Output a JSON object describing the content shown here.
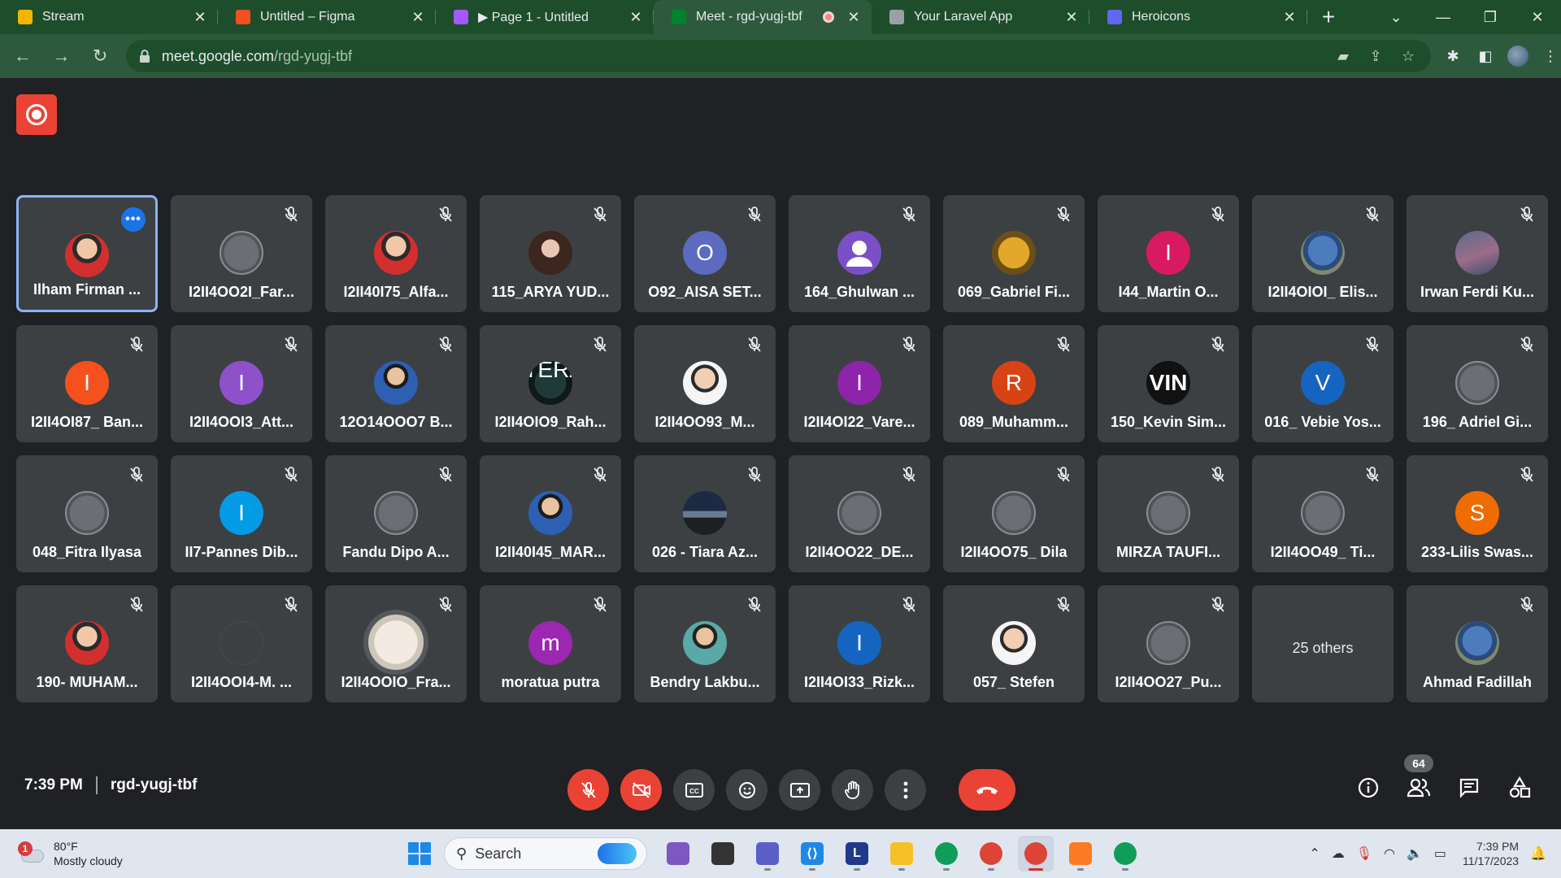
{
  "browser": {
    "tabs": [
      {
        "title": "Stream",
        "icon": "stream-icon",
        "color": "#f4b400"
      },
      {
        "title": "Untitled – Figma",
        "icon": "figma-icon",
        "color": "#f24e1e"
      },
      {
        "title": "▶ Page 1 - Untitled",
        "icon": "figma-icon",
        "color": "#a259ff"
      },
      {
        "title": "Meet - rgd-yugj-tbf",
        "icon": "meet-icon",
        "color": "#00832d",
        "active": true,
        "recording": true
      },
      {
        "title": "Your Laravel App",
        "icon": "globe-icon",
        "color": "#9aa0a6"
      },
      {
        "title": "Heroicons",
        "icon": "heroicons-icon",
        "color": "#6366f1"
      }
    ],
    "url_host": "meet.google.com",
    "url_path": "/rgd-yugj-tbf",
    "theme_color": "#2d5a3d"
  },
  "meeting": {
    "time": "7:39 PM",
    "code": "rgd-yugj-tbf",
    "participant_count": "64",
    "participants": [
      {
        "name": "Ilham Firman ...",
        "avatar": "photo",
        "speaking": true
      },
      {
        "name": "I2II4OO2I_Far...",
        "avatar": "grey"
      },
      {
        "name": "I2II40I75_Alfa...",
        "avatar": "photo"
      },
      {
        "name": "115_ARYA YUD...",
        "avatar": "anime"
      },
      {
        "name": "O92_AISA SET...",
        "avatar": "letter",
        "letter": "O",
        "color": "#5c6bc0"
      },
      {
        "name": "164_Ghulwan ...",
        "avatar": "person-icon",
        "color": "#7b4fc6"
      },
      {
        "name": "069_Gabriel Fi...",
        "avatar": "dog"
      },
      {
        "name": "I44_Martin O...",
        "avatar": "letter",
        "letter": "I",
        "color": "#d81b60"
      },
      {
        "name": "I2II4OIOI_ Elis...",
        "avatar": "logo"
      },
      {
        "name": "Irwan Ferdi Ku...",
        "avatar": "sky"
      },
      {
        "name": "I2II4OI87_ Ban...",
        "avatar": "letter",
        "letter": "I",
        "color": "#f4511e"
      },
      {
        "name": "I2II4OOI3_Att...",
        "avatar": "letter",
        "letter": "I",
        "color": "#8e51c9"
      },
      {
        "name": "12O14OOO7 B...",
        "avatar": "blueshirt"
      },
      {
        "name": "I2II4OIO9_Rah...",
        "avatar": "dark",
        "label": "ITERA II"
      },
      {
        "name": "I2II4OO93_M...",
        "avatar": "white"
      },
      {
        "name": "I2II4OI22_Vare...",
        "avatar": "letter",
        "letter": "I",
        "color": "#8e24aa"
      },
      {
        "name": "089_Muhamm...",
        "avatar": "letter",
        "letter": "R",
        "color": "#d84315"
      },
      {
        "name": "150_Kevin Sim...",
        "avatar": "vin",
        "label": "VIN"
      },
      {
        "name": "016_ Vebie Yos...",
        "avatar": "letter",
        "letter": "V",
        "color": "#1565c0"
      },
      {
        "name": "196_ Adriel Gi...",
        "avatar": "grey"
      },
      {
        "name": "048_Fitra Ilyasa",
        "avatar": "grey"
      },
      {
        "name": "II7-Pannes Dib...",
        "avatar": "letter",
        "letter": "I",
        "color": "#039be5"
      },
      {
        "name": "Fandu Dipo A...",
        "avatar": "grey"
      },
      {
        "name": "I2II40I45_MAR...",
        "avatar": "blueshirt"
      },
      {
        "name": "026 - Tiara Az...",
        "avatar": "dusk"
      },
      {
        "name": "I2II4OO22_DE...",
        "avatar": "grey"
      },
      {
        "name": "I2II4OO75_ Dila",
        "avatar": "grey"
      },
      {
        "name": "MIRZA TAUFI...",
        "avatar": "grey"
      },
      {
        "name": "I2II4OO49_ Ti...",
        "avatar": "grey"
      },
      {
        "name": "233-Lilis Swas...",
        "avatar": "letter",
        "letter": "S",
        "color": "#ef6c00"
      },
      {
        "name": "190- MUHAM...",
        "avatar": "photo"
      },
      {
        "name": "I2II4OOI4-M. ...",
        "avatar": "faint"
      },
      {
        "name": "I2II4OOIO_Fra...",
        "avatar": "sheet"
      },
      {
        "name": "moratua putra",
        "avatar": "letter",
        "letter": "m",
        "color": "#9c27b0",
        "no_mic": true
      },
      {
        "name": "Bendry Lakbu...",
        "avatar": "teal"
      },
      {
        "name": "I2II4OI33_Rizk...",
        "avatar": "letter",
        "letter": "I",
        "color": "#1565c0"
      },
      {
        "name": "057_ Stefen",
        "avatar": "white"
      },
      {
        "name": "I2II4OO27_Pu...",
        "avatar": "grey"
      },
      {
        "name": "25 others",
        "avatar": "none",
        "others": true
      },
      {
        "name": "Ahmad Fadillah",
        "avatar": "logo"
      }
    ]
  },
  "controls": {
    "mic": "mic-off-icon",
    "camera": "camera-off-icon",
    "captions": "captions-icon",
    "reactions": "emoji-icon",
    "present": "present-icon",
    "raise_hand": "hand-icon",
    "more": "more-vert-icon",
    "end": "end-call-icon"
  },
  "taskbar": {
    "weather_badge": "1",
    "temperature": "80°F",
    "condition": "Mostly cloudy",
    "search_placeholder": "Search",
    "clock_time": "7:39 PM",
    "clock_date": "11/17/2023",
    "apps": [
      {
        "name": "copilot-app-icon",
        "color": "#7e57c2",
        "label": ""
      },
      {
        "name": "task-view-icon",
        "color": "#333333",
        "label": ""
      },
      {
        "name": "teams-icon",
        "color": "#5b5fc7",
        "label": ""
      },
      {
        "name": "vscode-icon",
        "color": "#1e88e5",
        "label": "⟨⟩"
      },
      {
        "name": "laragon-icon",
        "color": "#1f3a8a",
        "label": "L"
      },
      {
        "name": "file-explorer-icon",
        "color": "#f6c026",
        "label": ""
      },
      {
        "name": "edge-icon",
        "color": "#0f9d58",
        "label": ""
      },
      {
        "name": "chrome-icon",
        "color": "#db4437",
        "label": ""
      },
      {
        "name": "chrome-profile-icon",
        "color": "#db4437",
        "label": "",
        "active": true
      },
      {
        "name": "xampp-icon",
        "color": "#fb7a24",
        "label": ""
      },
      {
        "name": "chrome-profile-2-icon",
        "color": "#0f9d58",
        "label": ""
      }
    ]
  }
}
